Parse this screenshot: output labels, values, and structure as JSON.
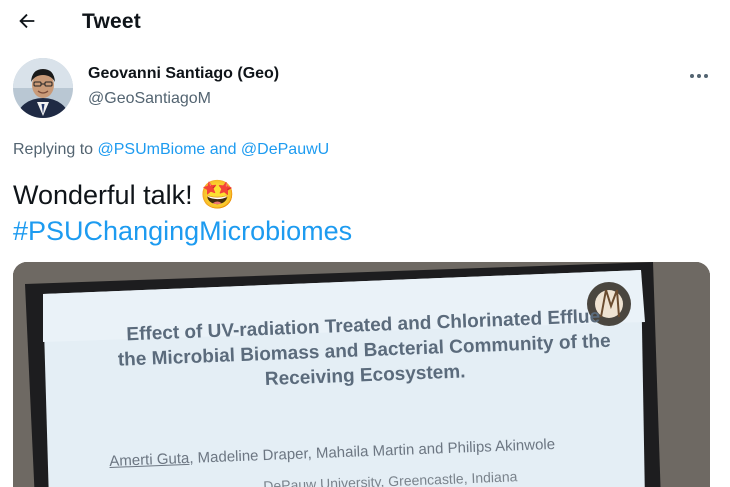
{
  "header": {
    "title": "Tweet",
    "back_icon": "arrow-left-icon"
  },
  "author": {
    "name": "Geovanni Santiago (Geo)",
    "handle": "@GeoSantiagoM",
    "more_icon": "more-horizontal-icon"
  },
  "reply": {
    "prefix": "Replying to ",
    "mention_1": "@PSUmBiome",
    "joiner": " and ",
    "mention_2": "@DePauwU"
  },
  "tweet": {
    "text": "Wonderful talk! ",
    "emoji": "🤩",
    "hashtag": "#PSUChangingMicrobiomes"
  },
  "media": {
    "slide_title_line_1": "Effect of UV-radiation Treated and Chlorinated Efflue",
    "slide_title_line_2": "the Microbial Biomass and Bacterial Community of the",
    "slide_title_line_3": "Receiving Ecosystem.",
    "slide_author_first": "Amerti Guta",
    "slide_authors_rest": ", Madeline Draper, Mahaila Martin and Philips Akinwole",
    "slide_affiliation": "DePauw University, Greencastle, Indiana"
  },
  "colors": {
    "link": "#1d9bf0",
    "secondary_text": "#536471",
    "primary_text": "#0f1419"
  }
}
